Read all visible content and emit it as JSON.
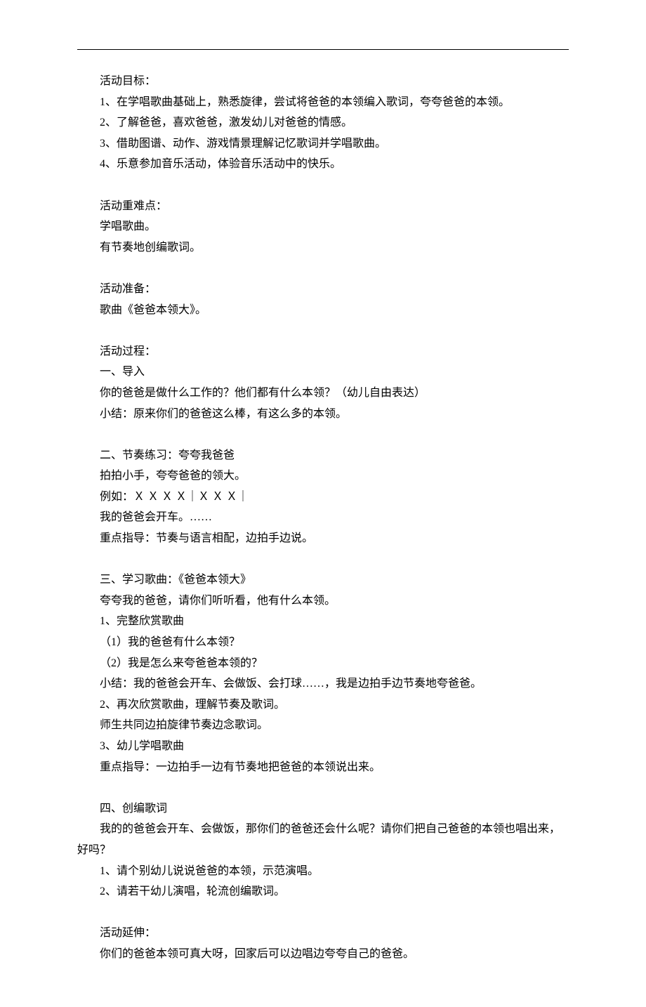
{
  "sections": [
    {
      "heading": "活动目标：",
      "lines": [
        "1、在学唱歌曲基础上，熟悉旋律，尝试将爸爸的本领编入歌词，夸夸爸爸的本领。",
        "2、了解爸爸，喜欢爸爸，激发幼儿对爸爸的情感。",
        "3、借助图谱、动作、游戏情景理解记忆歌词并学唱歌曲。",
        "4、乐意参加音乐活动，体验音乐活动中的快乐。"
      ]
    },
    {
      "heading": "活动重难点：",
      "lines": [
        "学唱歌曲。",
        "有节奏地创编歌词。"
      ]
    },
    {
      "heading": "活动准备：",
      "lines": [
        "歌曲《爸爸本领大》。"
      ]
    },
    {
      "heading": "活动过程：",
      "lines": [
        "一、导入",
        "你的爸爸是做什么工作的？他们都有什么本领？（幼儿自由表达）",
        "小结：原来你们的爸爸这么棒，有这么多的本领。"
      ]
    },
    {
      "heading": "二、节奏练习：夸夸我爸爸",
      "lines": [
        "拍拍小手，夸夸爸爸的领大。",
        "例如：Ｘ Ｘ Ｘ Ｘ｜Ｘ Ｘ Ｘ｜",
        "我的爸爸会开车。……",
        "重点指导：节奏与语言相配，边拍手边说。"
      ]
    },
    {
      "heading": "三、学习歌曲：《爸爸本领大》",
      "lines": [
        "夸夸我的爸爸，请你们听听看，他有什么本领。",
        "1、完整欣赏歌曲",
        "（1）我的爸爸有什么本领？",
        "（2）我是怎么来夸爸爸本领的？",
        "小结：我的爸爸会开车、会做饭、会打球……，我是边拍手边节奏地夸爸爸。",
        "2、再次欣赏歌曲，理解节奏及歌词。",
        "师生共同边拍旋律节奏边念歌词。",
        "3、幼儿学唱歌曲",
        "重点指导：一边拍手一边有节奏地把爸爸的本领说出来。"
      ]
    },
    {
      "heading": "四、创编歌词",
      "lines": [
        {
          "noIndent": true,
          "text": "　　我的的爸爸会开车、会做饭，那你们的爸爸还会什么呢？请你们把自己爸爸的本领也唱出来，好吗？"
        },
        "1、请个别幼儿说说爸爸的本领，示范演唱。",
        "2、请若干幼儿演唱，轮流创编歌词。"
      ]
    },
    {
      "heading": "活动延伸：",
      "lines": [
        "你们的爸爸本领可真大呀，回家后可以边唱边夸夸自己的爸爸。"
      ]
    }
  ]
}
